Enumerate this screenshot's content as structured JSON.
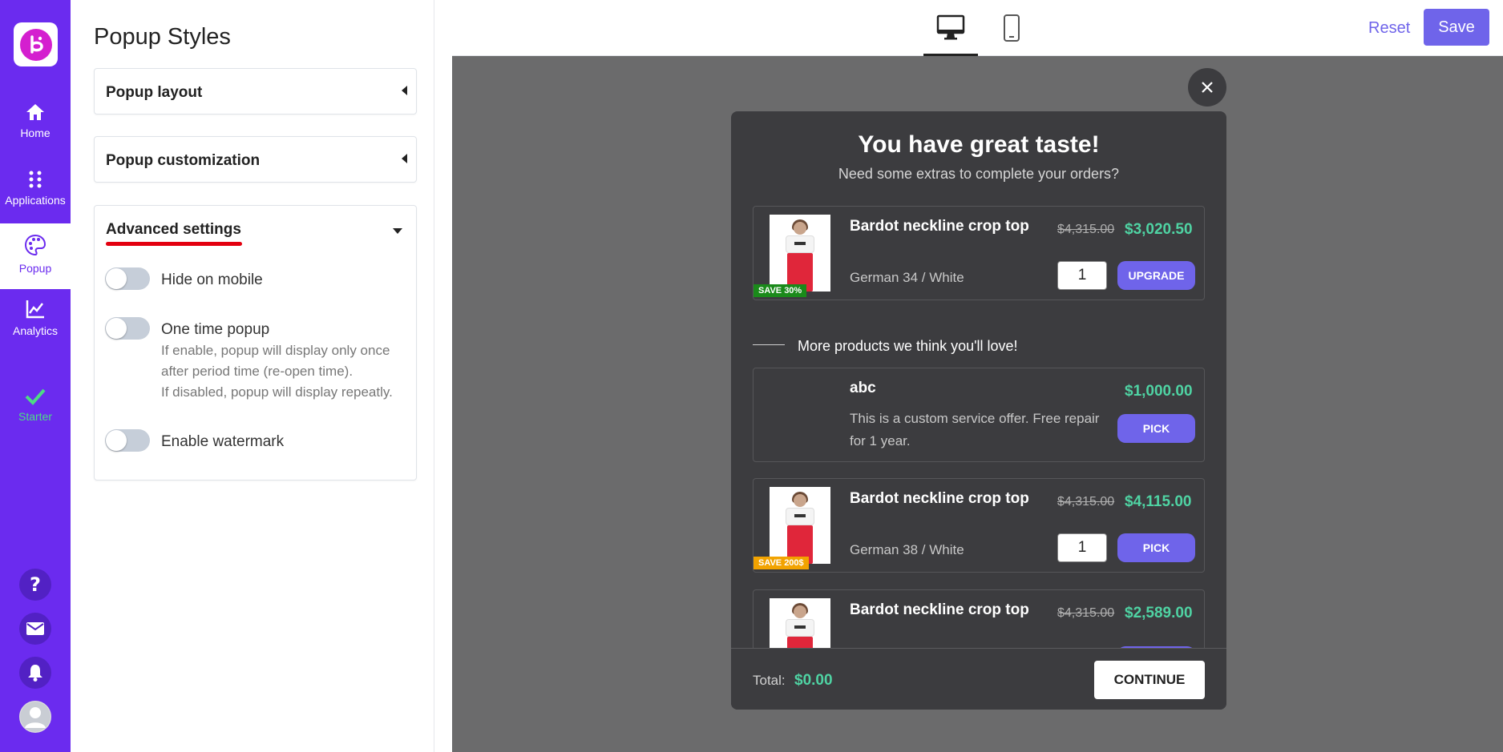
{
  "nav": {
    "logo_icon": "brand-logo-icon",
    "items": [
      {
        "label": "Home",
        "icon": "home-icon"
      },
      {
        "label": "Applications",
        "icon": "apps-grid-icon"
      },
      {
        "label": "Popup",
        "icon": "palette-icon"
      },
      {
        "label": "Analytics",
        "icon": "chart-line-icon"
      },
      {
        "label": "Starter",
        "icon": "check-icon"
      }
    ],
    "bottom_icons": [
      "help-icon",
      "mail-icon",
      "bell-icon",
      "avatar-icon"
    ],
    "colors": {
      "background": "#6b2bef",
      "starter": "#4ddc84"
    }
  },
  "panel": {
    "title": "Popup Styles",
    "sections": [
      {
        "label": "Popup layout",
        "state": "collapsed"
      },
      {
        "label": "Popup customization",
        "state": "collapsed"
      },
      {
        "label": "Advanced settings",
        "state": "expanded"
      }
    ],
    "toggles": [
      {
        "label": "Hide on mobile",
        "on": false
      },
      {
        "label": "One time popup",
        "on": false
      },
      {
        "label": "Enable watermark",
        "on": false
      }
    ],
    "one_time_help": [
      "If enable, popup will display only once",
      "after period time (re-open time).",
      "If disabled, popup will display repeatly."
    ]
  },
  "toolbar": {
    "devices": [
      "desktop-icon",
      "mobile-icon"
    ],
    "active_device": "desktop",
    "reset_label": "Reset",
    "save_label": "Save",
    "accent": "#6f64ea"
  },
  "popup": {
    "title": "You have great taste!",
    "subtitle": "Need some extras to complete your orders?",
    "items": [
      {
        "name": "Bardot neckline crop top",
        "variant": "German 34 / White",
        "old_price": "$4,315.00",
        "price": "$3,020.50",
        "qty": "1",
        "action": "UPGRADE",
        "badge": "SAVE 30%"
      },
      {
        "name": "abc",
        "description": "This is a custom service offer. Free repair for 1 year.",
        "price": "$1,000.00",
        "action": "PICK"
      },
      {
        "name": "Bardot neckline crop top",
        "variant": "German 38 / White",
        "old_price": "$4,315.00",
        "price": "$4,115.00",
        "qty": "1",
        "action": "PICK",
        "badge": "SAVE 200$"
      },
      {
        "name": "Bardot neckline crop top",
        "old_price": "$4,315.00",
        "price": "$2,589.00"
      }
    ],
    "recommend_heading": "More products we think you'll love!",
    "total_label": "Total:",
    "total_value": "$0.00",
    "continue_label": "CONTINUE",
    "colors": {
      "background": "#3c3c3f",
      "price": "#4fd3a3",
      "button": "#6f64ea"
    }
  }
}
